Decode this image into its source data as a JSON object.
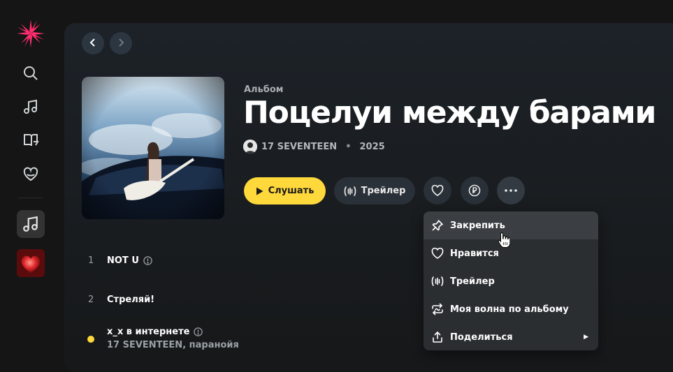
{
  "sidebar": {
    "items": [
      {
        "icon": "search-icon"
      },
      {
        "icon": "music-note-icon"
      },
      {
        "icon": "book-icon"
      },
      {
        "icon": "heart-wave-icon"
      }
    ],
    "active_icon": "music-note-icon",
    "cover_icon": "heart-cover-icon"
  },
  "nav": {
    "back_icon": "chevron-left-icon",
    "forward_icon": "chevron-right-icon"
  },
  "album": {
    "kind": "Альбом",
    "title": "Поцелуи между барами",
    "artist": "17 SEVENTEEN",
    "year": "2025"
  },
  "actions": {
    "play_label": "Слушать",
    "trailer_label": "Трейлер"
  },
  "tracks": [
    {
      "num": "1",
      "title": "NOT U",
      "has_info": true
    },
    {
      "num": "2",
      "title": "Стреляй!",
      "has_info": false
    },
    {
      "num": "",
      "title": "x_x в интернете",
      "artists": "17 SEVENTEEN, паранойя",
      "has_info": true,
      "playing": true
    }
  ],
  "menu": {
    "items": [
      {
        "label": "Закрепить",
        "icon": "pin-icon",
        "hover": true
      },
      {
        "label": "Нравится",
        "icon": "heart-icon"
      },
      {
        "label": "Трейлер",
        "icon": "trailer-icon"
      },
      {
        "label": "Моя волна по альбому",
        "icon": "wave-icon"
      },
      {
        "label": "Поделиться",
        "icon": "share-icon",
        "submenu": true
      }
    ]
  },
  "colors": {
    "accent": "#ffd83b",
    "logo": "#ff2d6f",
    "menu_bg": "#2b2e31"
  }
}
